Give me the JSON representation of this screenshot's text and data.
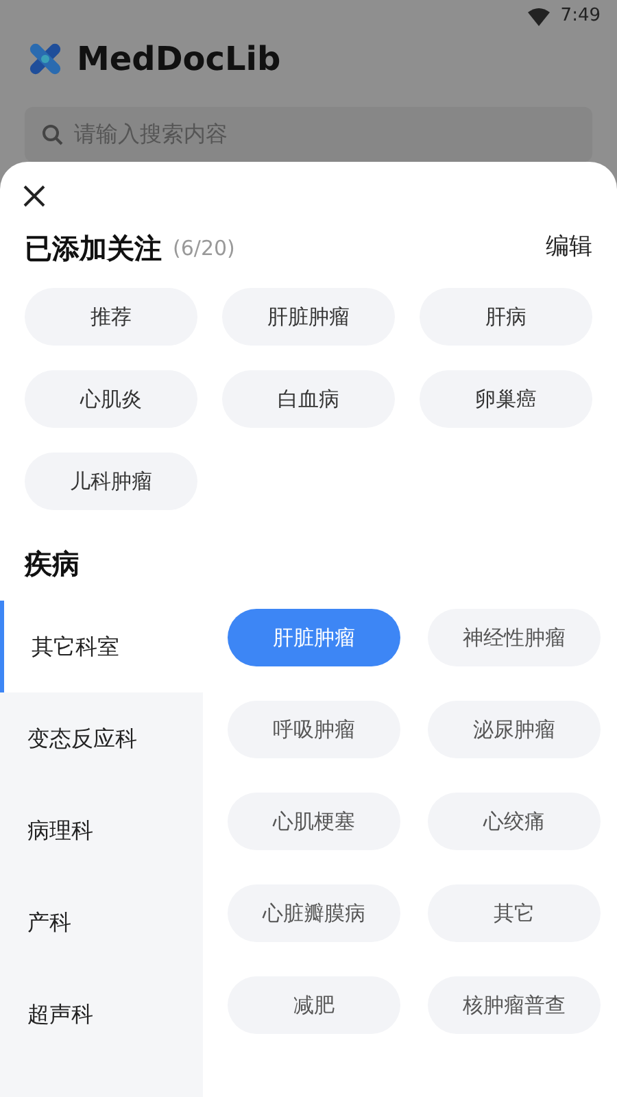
{
  "status_bar": {
    "time": "7:49"
  },
  "app": {
    "title": "MedDocLib",
    "search": {
      "placeholder": "请输入搜索内容"
    }
  },
  "sheet": {
    "followed": {
      "title": "已添加关注",
      "count": "(6/20)",
      "edit": "编辑",
      "tags": [
        "推荐",
        "肝脏肿瘤",
        "肝病",
        "心肌炎",
        "白血病",
        "卵巢癌",
        "儿科肿瘤"
      ]
    },
    "disease": {
      "title": "疾病",
      "departments": [
        {
          "label": "其它科室",
          "selected": true
        },
        {
          "label": "变态反应科",
          "selected": false
        },
        {
          "label": "病理科",
          "selected": false
        },
        {
          "label": "产科",
          "selected": false
        },
        {
          "label": "超声科",
          "selected": false
        }
      ],
      "topics": [
        {
          "label": "肝脏肿瘤",
          "selected": true
        },
        {
          "label": "神经性肿瘤",
          "selected": false
        },
        {
          "label": "呼吸肿瘤",
          "selected": false
        },
        {
          "label": "泌尿肿瘤",
          "selected": false
        },
        {
          "label": "心肌梗塞",
          "selected": false
        },
        {
          "label": "心绞痛",
          "selected": false
        },
        {
          "label": "心脏瓣膜病",
          "selected": false
        },
        {
          "label": "其它",
          "selected": false
        },
        {
          "label": "减肥",
          "selected": false
        },
        {
          "label": "核肿瘤普查",
          "selected": false
        }
      ]
    }
  }
}
